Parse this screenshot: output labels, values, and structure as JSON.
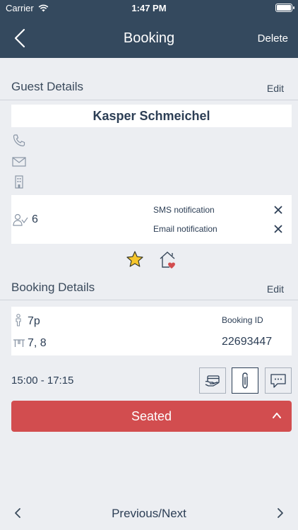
{
  "status_bar": {
    "carrier": "Carrier",
    "time": "1:47 PM"
  },
  "nav": {
    "title": "Booking",
    "delete_label": "Delete"
  },
  "guest_details": {
    "section_title": "Guest Details",
    "edit_label": "Edit",
    "guest_name": "Kasper Schmeichel",
    "party_count": "6",
    "notifications": [
      {
        "label": "SMS notification"
      },
      {
        "label": "Email notification"
      }
    ]
  },
  "booking_details": {
    "section_title": "Booking Details",
    "edit_label": "Edit",
    "people": "7p",
    "tables": "7, 8",
    "booking_id_label": "Booking ID",
    "booking_id": "22693447",
    "time_range": "15:00 - 17:15"
  },
  "seated_button": {
    "label": "Seated"
  },
  "pager": {
    "label": "Previous/Next"
  },
  "colors": {
    "header_bg": "#34495e",
    "seated_red": "#d24d4f",
    "star_gold": "#f6c62b",
    "heart_red": "#d24d4f"
  }
}
